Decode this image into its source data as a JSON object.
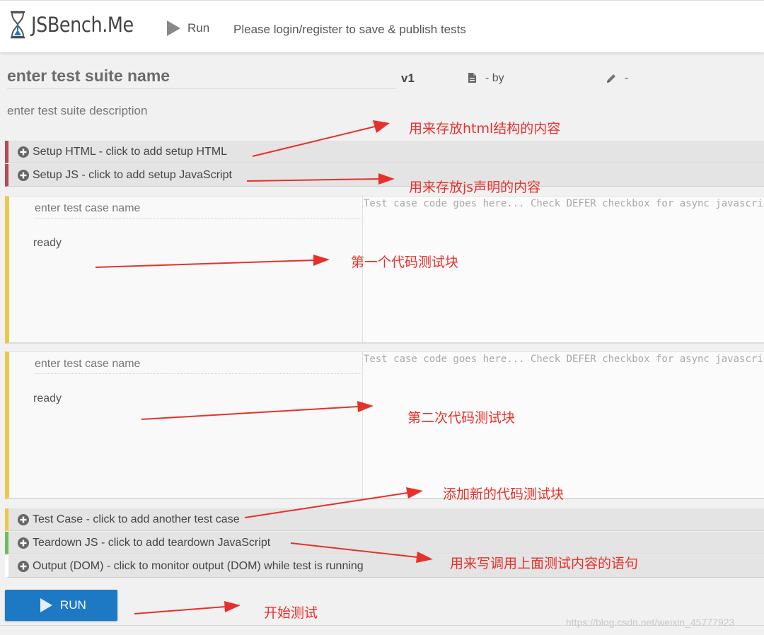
{
  "header": {
    "logo_text": "JSBench.Me",
    "run_label": "Run",
    "login_message": "Please login/register to save & publish tests"
  },
  "suite": {
    "name_placeholder": "enter test suite name",
    "version": "v1",
    "by_text": "- by",
    "edit_dash": "-",
    "description_placeholder": "enter test suite description"
  },
  "rows": {
    "setup_html": "Setup HTML - click to add setup HTML",
    "setup_js": "Setup JS - click to add setup JavaScript",
    "add_test_case": "Test Case - click to add another test case",
    "teardown_js": "Teardown JS - click to add teardown JavaScript",
    "output_dom": "Output (DOM) - click to monitor output (DOM) while test is running"
  },
  "test_cases": [
    {
      "name_placeholder": "enter test case name",
      "status": "ready",
      "code_placeholder": "Test case code goes here... Check DEFER checkbox for async javascript"
    },
    {
      "name_placeholder": "enter test case name",
      "status": "ready",
      "code_placeholder": "Test case code goes here... Check DEFER checkbox for async javascript"
    }
  ],
  "run_button_label": "RUN",
  "watermark": "https://blog.csdn.net/weixin_45777923",
  "annotations": {
    "setup_html": "用来存放html结构的内容",
    "setup_js": "用来存放js声明的内容",
    "case1": "第一个代码测试块",
    "case2": "第二次代码测试块",
    "add_case": "添加新的代码测试块",
    "teardown": "用来写调用上面测试内容的语句",
    "run": "开始测试"
  },
  "colors": {
    "setup_bar": "#b54a52",
    "case_bar": "#e8c94a",
    "teardown_bar": "#6fbd5a",
    "run_button": "#1e79c4",
    "annotation": "#e8302a"
  }
}
